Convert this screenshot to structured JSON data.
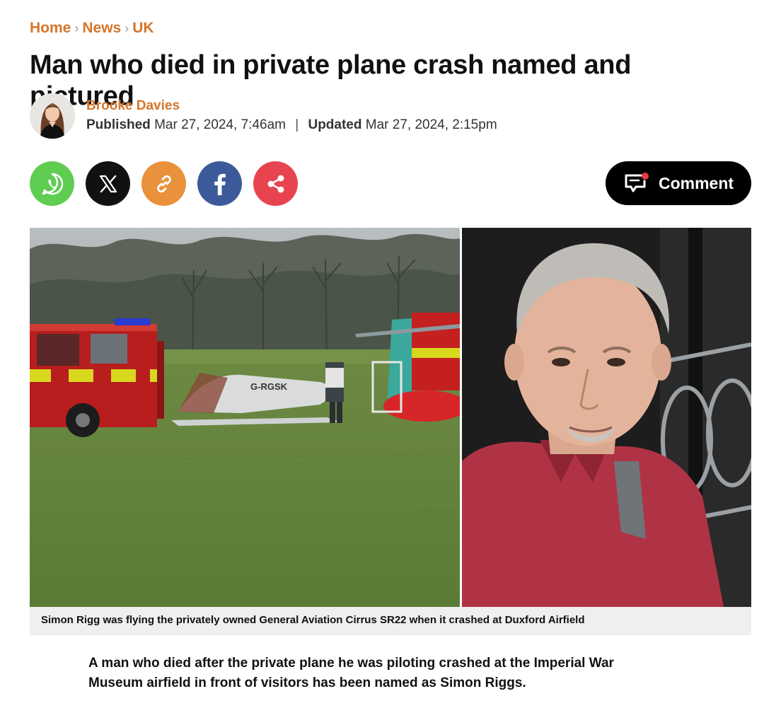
{
  "breadcrumb": {
    "items": [
      "Home",
      "News",
      "UK"
    ],
    "separator": "›"
  },
  "article": {
    "headline": "Man who died in private plane crash named and pictured",
    "author": "Brooke Davies",
    "published_label": "Published",
    "published_date": "Mar 27, 2024, 7:46am",
    "updated_label": "Updated",
    "updated_date": "Mar 27, 2024, 2:15pm",
    "caption": "Simon Rigg was flying the privately owned General Aviation Cirrus SR22 when it crashed at Duxford Airfield",
    "lede": "A man who died after the private plane he was piloting crashed at the Imperial War Museum airfield in front of visitors has been named as Simon Riggs."
  },
  "share": {
    "buttons": [
      {
        "icon": "whatsapp-icon",
        "color": "#5fcd52"
      },
      {
        "icon": "x-icon",
        "color": "#111111"
      },
      {
        "icon": "link-icon",
        "color": "#e9913b"
      },
      {
        "icon": "facebook-icon",
        "color": "#3c5a9a"
      },
      {
        "icon": "share-icon",
        "color": "#e74450"
      }
    ]
  },
  "comment": {
    "label": "Comment",
    "icon": "comment-icon",
    "notification_dot_color": "#e63946"
  },
  "photo": {
    "plane_registration": "G-RGSK"
  },
  "colors": {
    "accent": "#d4762b",
    "text": "#111111",
    "caption_bg": "#efefef"
  }
}
